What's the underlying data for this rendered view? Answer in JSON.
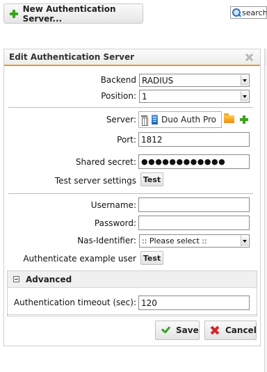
{
  "toolbar": {
    "new_server_label": "New Authentication Server...",
    "search_value": "search"
  },
  "panel": {
    "title": "Edit Authentication Server"
  },
  "form": {
    "backend_label": "Backend",
    "backend_value": "RADIUS",
    "position_label": "Position:",
    "position_value": "1",
    "server_label": "Server:",
    "server_value": "Duo Auth Pro",
    "port_label": "Port:",
    "port_value": "1812",
    "secret_label": "Shared secret:",
    "secret_value": "●●●●●●●●●●●●",
    "test_settings_label": "Test server settings",
    "test_label": "Test",
    "username_label": "Username:",
    "username_value": "",
    "password_label": "Password:",
    "password_value": "",
    "nas_label": "Nas-Identifier:",
    "nas_value": ":: Please select ::",
    "auth_example_label": "Authenticate example user",
    "test_label_2": "Test"
  },
  "advanced": {
    "title": "Advanced",
    "timeout_label": "Authentication timeout (sec):",
    "timeout_value": "120"
  },
  "actions": {
    "save_label": "Save",
    "cancel_label": "Cancel"
  },
  "colors": {
    "accent": "#e8962c",
    "add_green": "#3aa31b",
    "cancel_red": "#d4262a"
  }
}
